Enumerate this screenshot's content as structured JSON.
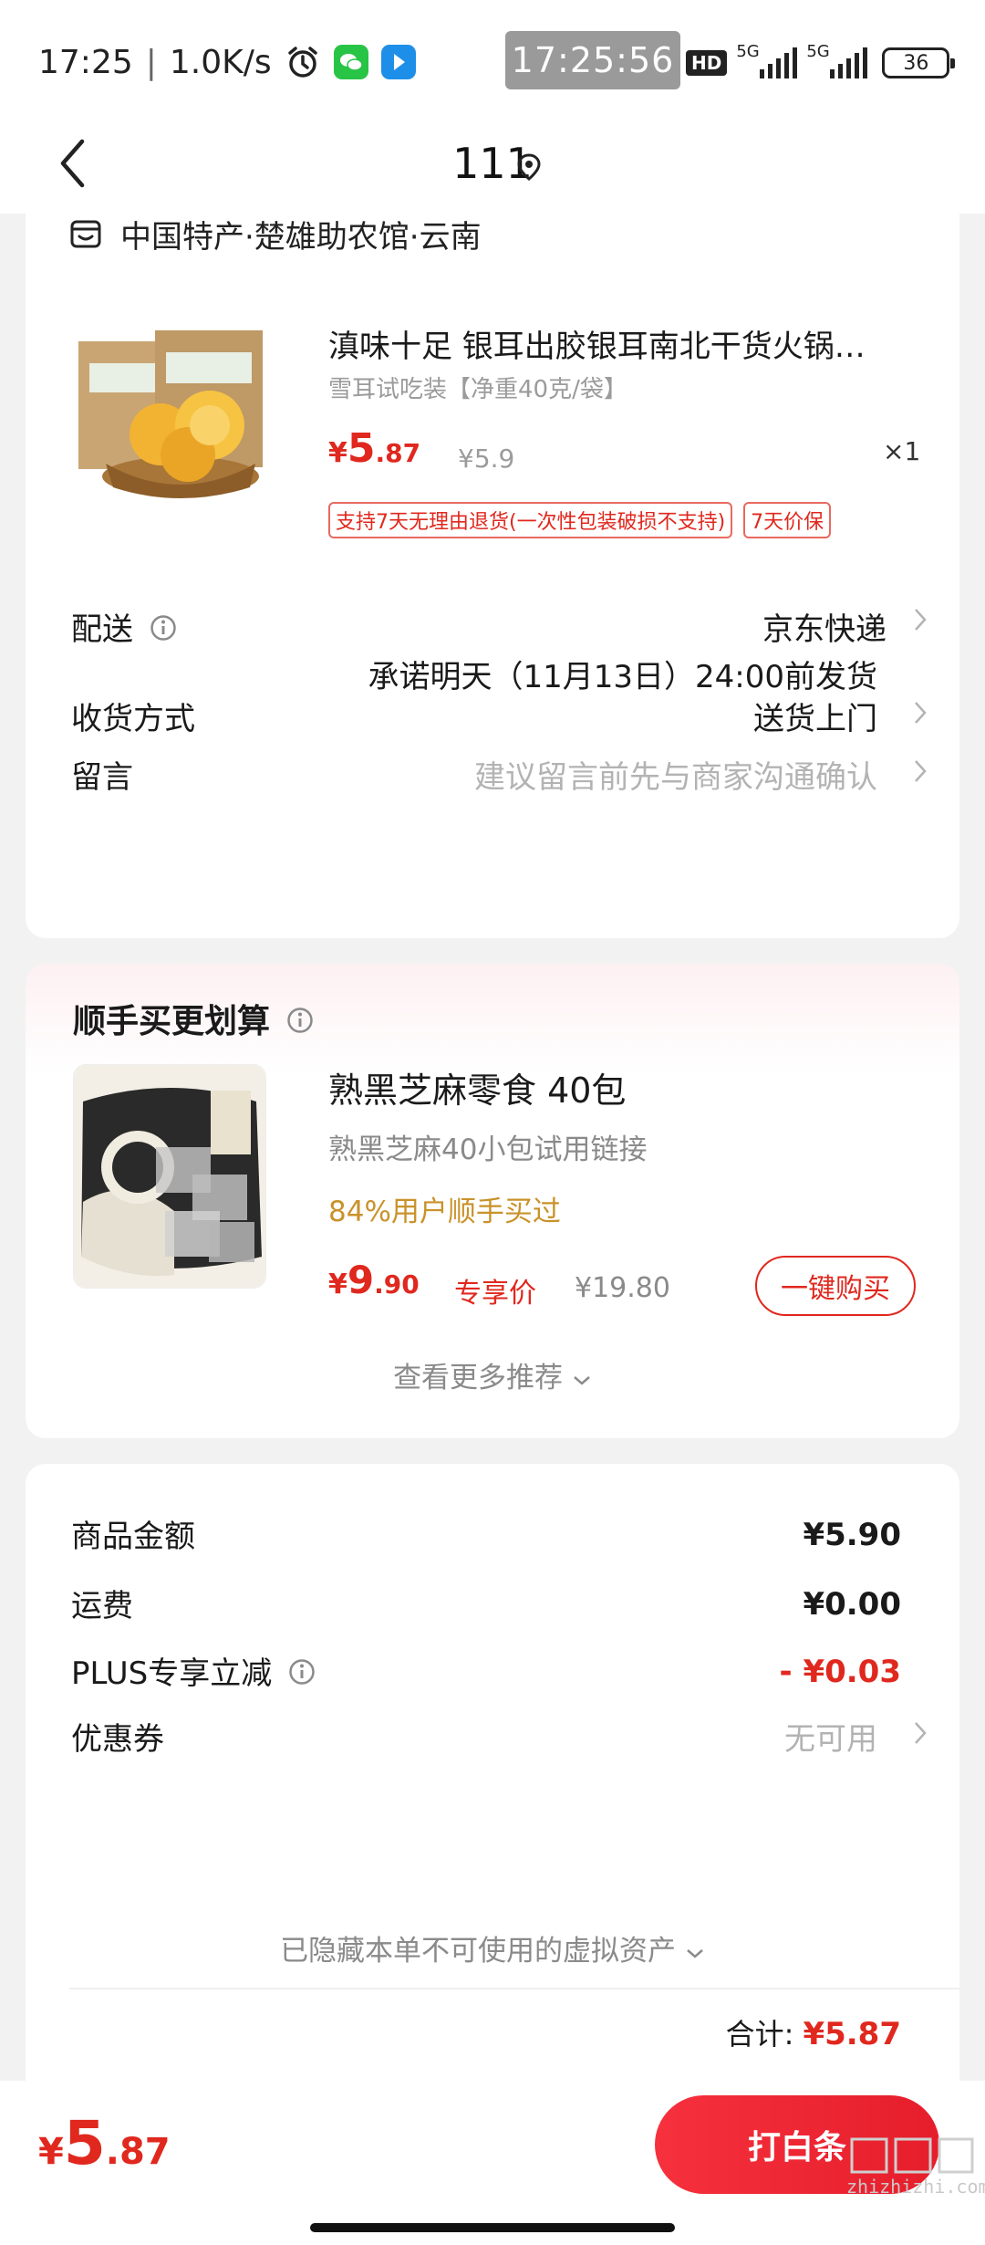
{
  "status_bar": {
    "time": "17:25",
    "speed": "1.0K/s",
    "clock_overlay": "17:25:56",
    "hd_badge": "HD",
    "net1": "5G",
    "net2": "5G",
    "battery": "36"
  },
  "nav": {
    "title": "111",
    "icons": [
      "back-icon",
      "location-icon"
    ]
  },
  "order": {
    "shop_name": "中国特产·楚雄助农馆·云南",
    "product": {
      "title": "滇味十足 银耳出胶银耳南北干货火锅…",
      "spec": "雪耳试吃装【净重40克/袋】",
      "price_currency": "¥",
      "price_int": "5",
      "price_dec": ".87",
      "original_price": "¥5.9",
      "quantity": "×1",
      "tags": [
        "支持7天无理由退货(一次性包装破损不支持)",
        "7天价保"
      ]
    },
    "delivery_label": "配送",
    "delivery_value": "京东快递",
    "delivery_promise": "承诺明天（11月13日）24:00前发货",
    "receive_label": "收货方式",
    "receive_value": "送货上门",
    "message_label": "留言",
    "message_placeholder": "建议留言前先与商家沟通确认"
  },
  "recommend": {
    "title": "顺手买更划算",
    "item_name": "熟黑芝麻零食 40包",
    "item_desc": "熟黑芝麻40小包试用链接",
    "social_proof": "84%用户顺手买过",
    "price_currency": "¥",
    "price_int": "9",
    "price_dec": ".90",
    "exclusive_label": "专享价",
    "original_price": "¥19.80",
    "buy_label": "一键购买",
    "more_label": "查看更多推荐"
  },
  "summary": {
    "goods_label": "商品金额",
    "goods_value": "¥5.90",
    "shipping_label": "运费",
    "shipping_value": "¥0.00",
    "plus_label": "PLUS专享立减",
    "plus_value": "- ¥0.03",
    "coupon_label": "优惠券",
    "coupon_value": "无可用",
    "hidden_assets": "已隐藏本单不可使用的虚拟资产",
    "total_label": "合计:",
    "total_value": "¥5.87"
  },
  "bottom": {
    "price_currency": "¥",
    "price_int": "5",
    "price_dec": ".87",
    "pay_label": "打白条",
    "watermark": "zhizhizhi.com"
  },
  "colors": {
    "accent": "#e0281e",
    "gold": "#c9922a",
    "muted": "#9b9b9b"
  }
}
